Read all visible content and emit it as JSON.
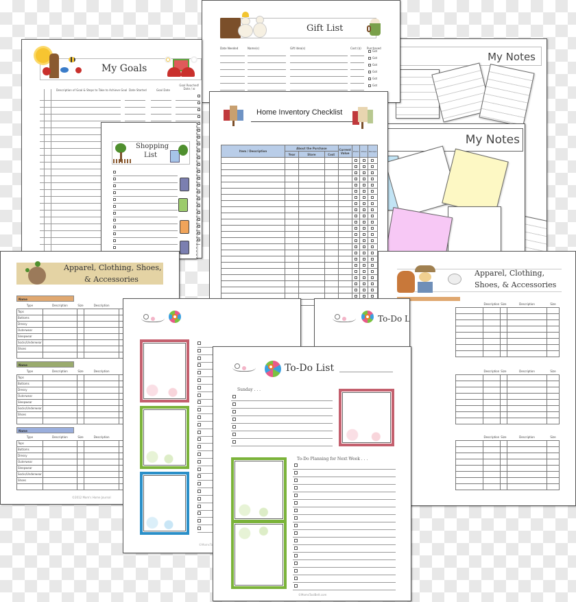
{
  "pages": {
    "gift_list": {
      "title": "Gift List",
      "columns": [
        "Date Needed",
        "Name(s)",
        "Gift Idea(s)",
        "Cost ($)",
        "Purchased"
      ],
      "purchased_option": "Got"
    },
    "my_goals": {
      "title": "My Goals",
      "columns": [
        "Description of Goal & Steps to Take to Achieve Goal",
        "Date Started",
        "Goal Date",
        "Goal Reached! Date / ☒"
      ]
    },
    "my_notes_back": {
      "title": "My Notes"
    },
    "my_notes_front": {
      "title": "My Notes"
    },
    "shopping_list": {
      "title_line1": "Shopping",
      "title_line2": "List"
    },
    "home_inventory": {
      "title": "Home Inventory Checklist",
      "columns": {
        "item": "Item / Description",
        "about": "About the Purchase",
        "year": "Year",
        "store": "Store",
        "cost": "Cost",
        "current_value": "Current Value",
        "photo": "Photo",
        "video": "Video",
        "receipt": "Receipt"
      }
    },
    "apparel_left": {
      "title_line1": "Apparel, Clothing, Shoes,",
      "title_line2": "& Accessories",
      "section_label": "Name",
      "columns": [
        "Type",
        "Description",
        "Size",
        "Description",
        "Size"
      ],
      "rows": [
        "Tops",
        "Bottoms",
        "Dressy",
        "Outerwear",
        "Sleepwear",
        "Socks/Underwear",
        "Shoes"
      ],
      "section_colors": [
        "#e0a870",
        "#9aab6e",
        "#9aaedc"
      ],
      "footer": "©2012 Mom's Home Journal"
    },
    "apparel_right": {
      "title_line1": "Apparel, Clothing,",
      "title_line2": "Shoes, & Accessories",
      "columns": [
        "Description",
        "Size",
        "Description",
        "Size"
      ]
    },
    "todo_left": {
      "footer": "©MomsToolbelt"
    },
    "todo_middle": {
      "title": "To-Do List"
    },
    "todo_front": {
      "title": "To-Do List",
      "day_label": "Sunday . . .",
      "planning_label": "To-Do Planning for Next Week . . .",
      "footer": "©MomsToolBelt.com"
    }
  },
  "colors": {
    "frame_pink": "#c4606e",
    "frame_green": "#7bb33a",
    "frame_blue": "#2a8fc8",
    "inventory_header": "#b9cde8",
    "note_yellow": "#fdf8c4",
    "note_pink": "#f7c8f5",
    "note_blue": "#c2e4f5"
  }
}
